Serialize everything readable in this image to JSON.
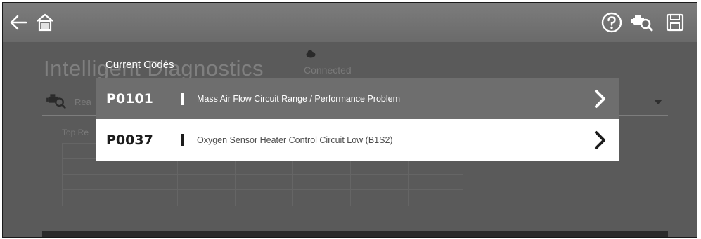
{
  "toolbar": {
    "back_icon": "back-arrow-icon",
    "home_icon": "home-icon",
    "help_icon": "help-icon",
    "vehicle_icon": "vehicle-scan-icon",
    "save_icon": "save-icon"
  },
  "background": {
    "title": "Intelligent Diagnostics",
    "status": "Connected",
    "field_label": "Rea",
    "section_label": "Top Re"
  },
  "modal": {
    "title": "Current Codes",
    "codes": [
      {
        "id": "P0101",
        "description": "Mass Air Flow Circuit Range / Performance Problem",
        "selected": true
      },
      {
        "id": "P0037",
        "description": "Oxygen Sensor Heater Control Circuit Low (B1S2)",
        "selected": false
      }
    ]
  },
  "colors": {
    "toolbar_bg": "#6a6a6a",
    "overlay_bg": "#5a5a5a",
    "selected_row": "#6e6e6e",
    "row_bg": "#ffffff"
  }
}
